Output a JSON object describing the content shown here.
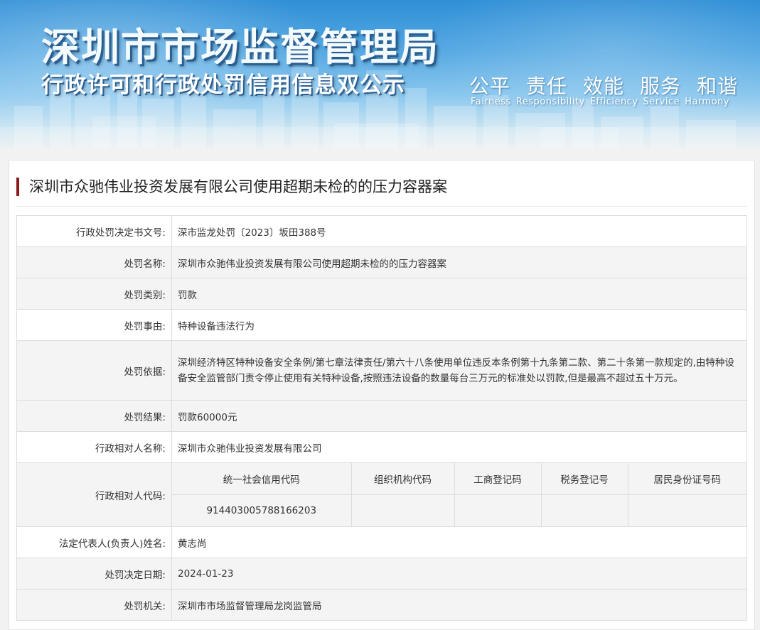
{
  "banner": {
    "title": "深圳市市场监督管理局",
    "subtitle": "行政许可和行政处罚信用信息双公示",
    "slogans_cn": [
      "公平",
      "责任",
      "效能",
      "服务",
      "和谐"
    ],
    "slogans_en": [
      "Fairness",
      "Responsibility",
      "Efficiency",
      "Service",
      "Harmony"
    ]
  },
  "case": {
    "title": "深圳市众驰伟业投资发展有限公司使用超期未检的的压力容器案"
  },
  "rows": [
    {
      "label": "行政处罚决定书文号:",
      "value": "深市监龙处罚〔2023〕坂田388号"
    },
    {
      "label": "处罚名称:",
      "value": "深圳市众驰伟业投资发展有限公司使用超期未检的的压力容器案"
    },
    {
      "label": "处罚类别:",
      "value": "罚款"
    },
    {
      "label": "处罚事由:",
      "value": "特种设备违法行为"
    },
    {
      "label": "处罚依据:",
      "value": "深圳经济特区特种设备安全条例/第七章法律责任/第六十八条使用单位违反本条例第十九条第二款、第二十条第一款规定的,由特种设备安全监管部门责令停止使用有关特种设备,按照违法设备的数量每台三万元的标准处以罚款,但是最高不超过五十万元。"
    },
    {
      "label": "处罚结果:",
      "value": "罚款60000元"
    },
    {
      "label": "行政相对人名称:",
      "value": "深圳市众驰伟业投资发展有限公司"
    }
  ],
  "codes": {
    "label": "行政相对人代码:",
    "headers": [
      "统一社会信用代码",
      "组织机构代码",
      "工商登记码",
      "税务登记号",
      "居民身份证号码"
    ],
    "values": [
      "914403005788166203",
      "",
      "",
      "",
      ""
    ]
  },
  "rows_after": [
    {
      "label": "法定代表人(负责人)姓名:",
      "value": "黄志尚"
    },
    {
      "label": "处罚决定日期:",
      "value": "2024-01-23"
    },
    {
      "label": "处罚机关:",
      "value": "深圳市市场监督管理局龙岗监管局"
    }
  ]
}
